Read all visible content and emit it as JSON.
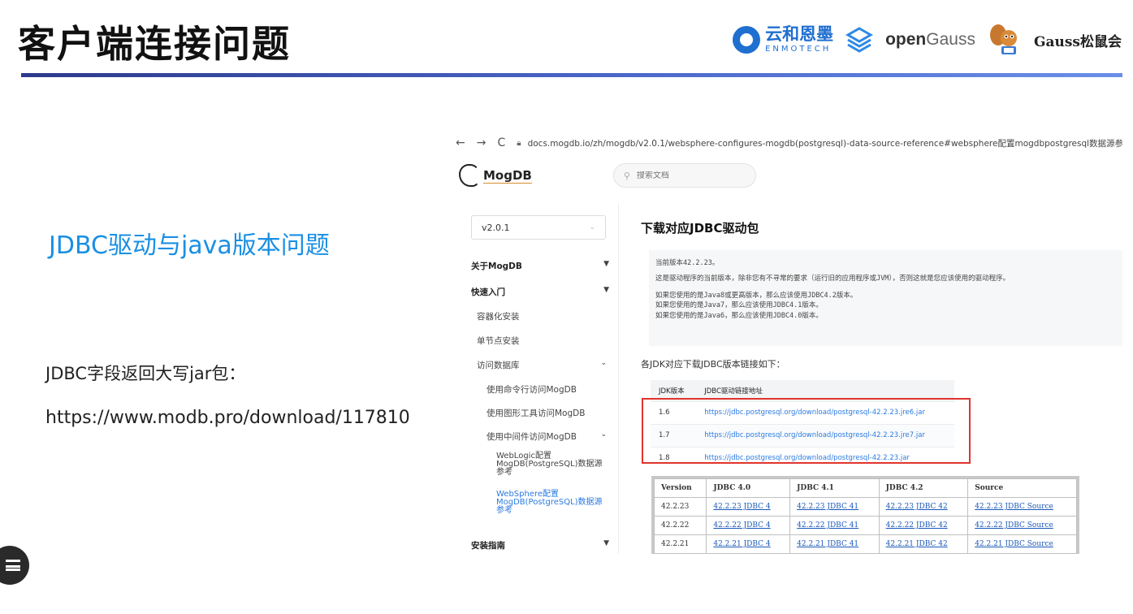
{
  "slide": {
    "title": "客户端连接问题",
    "subheading": "JDBC驱动与java版本问题",
    "note": "JDBC字段返回大写jar包：",
    "link": "https://www.modb.pro/download/117810"
  },
  "logos": {
    "enmo_cn": "云和恩墨",
    "enmo_en": "ENMOTECH",
    "opengauss_prefix": "open",
    "opengauss_suffix": "Gauss",
    "gauss_society": "Gauss松鼠会"
  },
  "browser": {
    "url": "docs.mogdb.io/zh/mogdb/v2.0.1/websphere-configures-mogdb(postgresql)-data-source-reference#websphere配置mogdbpostgresql数据源参",
    "back_icon": "arrow-left-icon",
    "forward_icon": "arrow-right-icon",
    "reload_icon": "reload-icon"
  },
  "site": {
    "logo_text": "MogDB",
    "search_placeholder": "搜索文档",
    "version": "v2.0.1",
    "nav": [
      {
        "label": "关于MogDB"
      },
      {
        "label": "快速入门"
      },
      {
        "label": "容器化安装"
      },
      {
        "label": "单节点安装"
      },
      {
        "label": "访问数据库"
      },
      {
        "label": "使用命令行访问MogDB"
      },
      {
        "label": "使用图形工具访问MogDB"
      },
      {
        "label": "使用中间件访问MogDB"
      },
      {
        "label": "WebLogic配置MogDB(PostgreSQL)数据源参考"
      },
      {
        "label": "WebSphere配置MogDB(PostgreSQL)数据源参考"
      },
      {
        "label": "安装指南"
      }
    ]
  },
  "doc": {
    "title": "下载对应JDBC驱动包",
    "code_lines": [
      "当前版本42.2.23。",
      "这是驱动程序的当前版本，除非您有不寻常的要求（运行旧的应用程序或JVM），否则这就是您应该使用的驱动程序。",
      "如果您使用的是Java8或更高版本，那么应该使用JDBC4.2版本。",
      "如果您使用的是Java7，那么应该使用JDBC4.1版本。",
      "如果您使用的是Java6，那么应该使用JDBC4.0版本。"
    ],
    "jdk_intro": "各JDK对应下载JDBC版本链接如下：",
    "jdk_headers": [
      "JDK版本",
      "JDBC驱动链接地址"
    ],
    "jdk_rows": [
      [
        "1.6",
        "https://jdbc.postgresql.org/download/postgresql-42.2.23.jre6.jar"
      ],
      [
        "1.7",
        "https://jdbc.postgresql.org/download/postgresql-42.2.23.jre7.jar"
      ],
      [
        "1.8",
        "https://jdbc.postgresql.org/download/postgresql-42.2.23.jar"
      ]
    ],
    "ver_headers": [
      "Version",
      "JDBC 4.0",
      "JDBC 4.1",
      "JDBC 4.2",
      "Source"
    ],
    "ver_rows": [
      [
        "42.2.23",
        "42.2.23 JDBC 4",
        "42.2.23 JDBC 41",
        "42.2.23 JDBC 42",
        "42.2.23 JDBC Source"
      ],
      [
        "42.2.22",
        "42.2.22 JDBC 4",
        "42.2.22 JDBC 41",
        "42.2.22 JDBC 42",
        "42.2.22 JDBC Source"
      ],
      [
        "42.2.21",
        "42.2.21 JDBC 4",
        "42.2.21 JDBC 41",
        "42.2.21 JDBC 42",
        "42.2.21 JDBC Source"
      ]
    ]
  },
  "colors": {
    "accent_blue": "#1a8fe3",
    "highlight_red": "#e0342e",
    "header_bar": "#4a67c9"
  }
}
